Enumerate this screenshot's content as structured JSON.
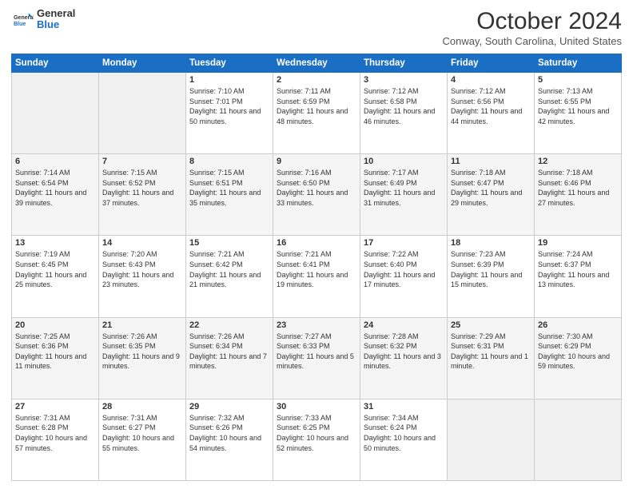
{
  "header": {
    "logo_line1": "General",
    "logo_line2": "Blue",
    "month_title": "October 2024",
    "location": "Conway, South Carolina, United States"
  },
  "days_of_week": [
    "Sunday",
    "Monday",
    "Tuesday",
    "Wednesday",
    "Thursday",
    "Friday",
    "Saturday"
  ],
  "weeks": [
    [
      {
        "day": "",
        "empty": true
      },
      {
        "day": "",
        "empty": true
      },
      {
        "day": "1",
        "sunrise": "7:10 AM",
        "sunset": "7:01 PM",
        "daylight": "11 hours and 50 minutes."
      },
      {
        "day": "2",
        "sunrise": "7:11 AM",
        "sunset": "6:59 PM",
        "daylight": "11 hours and 48 minutes."
      },
      {
        "day": "3",
        "sunrise": "7:12 AM",
        "sunset": "6:58 PM",
        "daylight": "11 hours and 46 minutes."
      },
      {
        "day": "4",
        "sunrise": "7:12 AM",
        "sunset": "6:56 PM",
        "daylight": "11 hours and 44 minutes."
      },
      {
        "day": "5",
        "sunrise": "7:13 AM",
        "sunset": "6:55 PM",
        "daylight": "11 hours and 42 minutes."
      }
    ],
    [
      {
        "day": "6",
        "sunrise": "7:14 AM",
        "sunset": "6:54 PM",
        "daylight": "11 hours and 39 minutes."
      },
      {
        "day": "7",
        "sunrise": "7:15 AM",
        "sunset": "6:52 PM",
        "daylight": "11 hours and 37 minutes."
      },
      {
        "day": "8",
        "sunrise": "7:15 AM",
        "sunset": "6:51 PM",
        "daylight": "11 hours and 35 minutes."
      },
      {
        "day": "9",
        "sunrise": "7:16 AM",
        "sunset": "6:50 PM",
        "daylight": "11 hours and 33 minutes."
      },
      {
        "day": "10",
        "sunrise": "7:17 AM",
        "sunset": "6:49 PM",
        "daylight": "11 hours and 31 minutes."
      },
      {
        "day": "11",
        "sunrise": "7:18 AM",
        "sunset": "6:47 PM",
        "daylight": "11 hours and 29 minutes."
      },
      {
        "day": "12",
        "sunrise": "7:18 AM",
        "sunset": "6:46 PM",
        "daylight": "11 hours and 27 minutes."
      }
    ],
    [
      {
        "day": "13",
        "sunrise": "7:19 AM",
        "sunset": "6:45 PM",
        "daylight": "11 hours and 25 minutes."
      },
      {
        "day": "14",
        "sunrise": "7:20 AM",
        "sunset": "6:43 PM",
        "daylight": "11 hours and 23 minutes."
      },
      {
        "day": "15",
        "sunrise": "7:21 AM",
        "sunset": "6:42 PM",
        "daylight": "11 hours and 21 minutes."
      },
      {
        "day": "16",
        "sunrise": "7:21 AM",
        "sunset": "6:41 PM",
        "daylight": "11 hours and 19 minutes."
      },
      {
        "day": "17",
        "sunrise": "7:22 AM",
        "sunset": "6:40 PM",
        "daylight": "11 hours and 17 minutes."
      },
      {
        "day": "18",
        "sunrise": "7:23 AM",
        "sunset": "6:39 PM",
        "daylight": "11 hours and 15 minutes."
      },
      {
        "day": "19",
        "sunrise": "7:24 AM",
        "sunset": "6:37 PM",
        "daylight": "11 hours and 13 minutes."
      }
    ],
    [
      {
        "day": "20",
        "sunrise": "7:25 AM",
        "sunset": "6:36 PM",
        "daylight": "11 hours and 11 minutes."
      },
      {
        "day": "21",
        "sunrise": "7:26 AM",
        "sunset": "6:35 PM",
        "daylight": "11 hours and 9 minutes."
      },
      {
        "day": "22",
        "sunrise": "7:26 AM",
        "sunset": "6:34 PM",
        "daylight": "11 hours and 7 minutes."
      },
      {
        "day": "23",
        "sunrise": "7:27 AM",
        "sunset": "6:33 PM",
        "daylight": "11 hours and 5 minutes."
      },
      {
        "day": "24",
        "sunrise": "7:28 AM",
        "sunset": "6:32 PM",
        "daylight": "11 hours and 3 minutes."
      },
      {
        "day": "25",
        "sunrise": "7:29 AM",
        "sunset": "6:31 PM",
        "daylight": "11 hours and 1 minute."
      },
      {
        "day": "26",
        "sunrise": "7:30 AM",
        "sunset": "6:29 PM",
        "daylight": "10 hours and 59 minutes."
      }
    ],
    [
      {
        "day": "27",
        "sunrise": "7:31 AM",
        "sunset": "6:28 PM",
        "daylight": "10 hours and 57 minutes."
      },
      {
        "day": "28",
        "sunrise": "7:31 AM",
        "sunset": "6:27 PM",
        "daylight": "10 hours and 55 minutes."
      },
      {
        "day": "29",
        "sunrise": "7:32 AM",
        "sunset": "6:26 PM",
        "daylight": "10 hours and 54 minutes."
      },
      {
        "day": "30",
        "sunrise": "7:33 AM",
        "sunset": "6:25 PM",
        "daylight": "10 hours and 52 minutes."
      },
      {
        "day": "31",
        "sunrise": "7:34 AM",
        "sunset": "6:24 PM",
        "daylight": "10 hours and 50 minutes."
      },
      {
        "day": "",
        "empty": true
      },
      {
        "day": "",
        "empty": true
      }
    ]
  ]
}
